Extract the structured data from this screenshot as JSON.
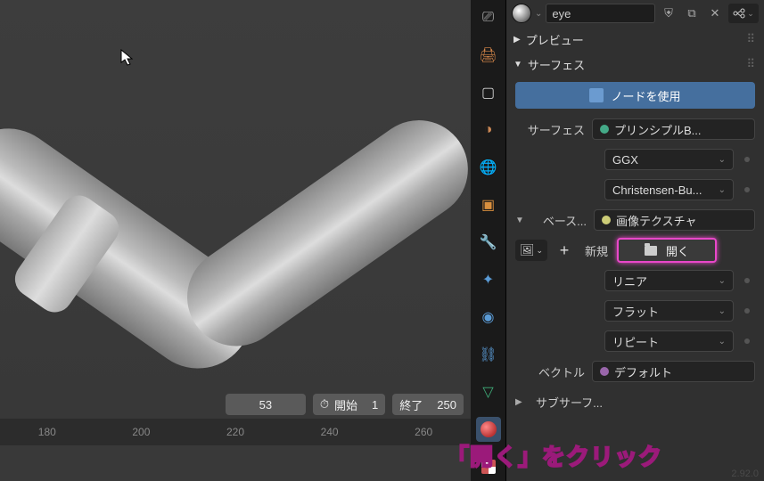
{
  "header": {
    "material_name": "eye"
  },
  "panels": {
    "preview": "プレビュー",
    "surface": "サーフェス"
  },
  "surface": {
    "use_nodes": "ノードを使用",
    "surface_label": "サーフェス",
    "surface_value": "プリンシプルB...",
    "distribution": "GGX",
    "subsurface_method": "Christensen-Bu...",
    "base_label": "ベース...",
    "base_value": "画像テクスチャ",
    "new_label": "新規",
    "open_label": "開く",
    "interpolation": "リニア",
    "projection": "フラット",
    "extension": "リピート",
    "vector_label": "ベクトル",
    "vector_value": "デフォルト",
    "subsurf_label": "サブサーフ..."
  },
  "timeline": {
    "current_frame": "53",
    "start_label": "開始",
    "start_value": "1",
    "end_label": "終了",
    "end_value": "250",
    "ticks": [
      "180",
      "200",
      "220",
      "240",
      "260"
    ]
  },
  "callout": "「開く」をクリック",
  "version": "2.92.0"
}
